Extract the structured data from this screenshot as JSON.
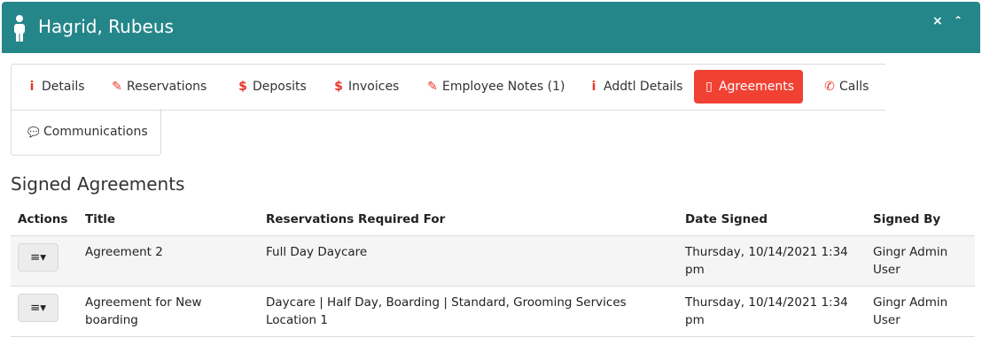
{
  "header": {
    "title": "Hagrid, Rubeus",
    "close": "×",
    "collapse": "⌃"
  },
  "tabs": [
    {
      "label": "Details",
      "icon": "i"
    },
    {
      "label": "Reservations",
      "icon": "✎"
    },
    {
      "label": "Deposits",
      "icon": "$"
    },
    {
      "label": "Invoices",
      "icon": "$"
    },
    {
      "label": "Employee Notes (1)",
      "icon": "✎"
    },
    {
      "label": "Addtl Details",
      "icon": "i"
    },
    {
      "label": "Agreements",
      "icon": "▯"
    },
    {
      "label": "Calls",
      "icon": "✆"
    },
    {
      "label": "Communications",
      "icon": "💬"
    }
  ],
  "section_title": "Signed Agreements",
  "table": {
    "headers": [
      "Actions",
      "Title",
      "Reservations Required For",
      "Date Signed",
      "Signed By"
    ],
    "rows": [
      {
        "title": "Agreement 2",
        "reservations": "Full Day Daycare",
        "date": "Thursday, 10/14/2021 1:34 pm",
        "signed_by": "Gingr Admin User"
      },
      {
        "title": "Agreement for New boarding",
        "reservations": "Daycare | Half Day, Boarding | Standard, Grooming Services Location 1",
        "date": "Thursday, 10/14/2021 1:34 pm",
        "signed_by": "Gingr Admin User"
      }
    ]
  },
  "action_icon": "≡▾",
  "colors": {
    "header_bg": "#25868a",
    "accent": "#f04133"
  }
}
